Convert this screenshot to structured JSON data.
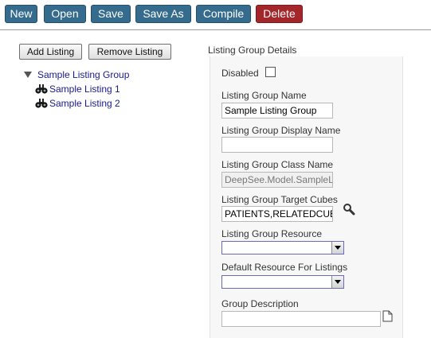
{
  "toolbar": {
    "new_label": "New",
    "open_label": "Open",
    "save_label": "Save",
    "save_as_label": "Save As",
    "compile_label": "Compile",
    "delete_label": "Delete"
  },
  "actions": {
    "add_listing_label": "Add Listing",
    "remove_listing_label": "Remove Listing"
  },
  "tree": {
    "group_label": "Sample Listing Group",
    "listings": [
      {
        "label": "Sample Listing 1",
        "icon": "binoculars-icon"
      },
      {
        "label": "Sample Listing 2",
        "icon": "binoculars-icon"
      }
    ]
  },
  "details": {
    "section_title": "Listing Group Details",
    "disabled_label": "Disabled",
    "disabled_checked": false,
    "name_label": "Listing Group Name",
    "name_value": "Sample Listing Group",
    "display_name_label": "Listing Group Display Name",
    "display_name_value": "",
    "class_name_label": "Listing Group Class Name",
    "class_name_value": "DeepSee.Model.SampleListingGroup",
    "target_cubes_label": "Listing Group Target Cubes",
    "target_cubes_value": "PATIENTS,RELATEDCUBES/CITYRAINFALL",
    "resource_label": "Listing Group Resource",
    "resource_value": "",
    "default_resource_label": "Default Resource For Listings",
    "default_resource_value": "",
    "description_label": "Group Description",
    "description_value": ""
  },
  "colors": {
    "toolbar_button": "#356b8d",
    "delete_button": "#a3262b",
    "tree_link": "#1a1a8c"
  }
}
